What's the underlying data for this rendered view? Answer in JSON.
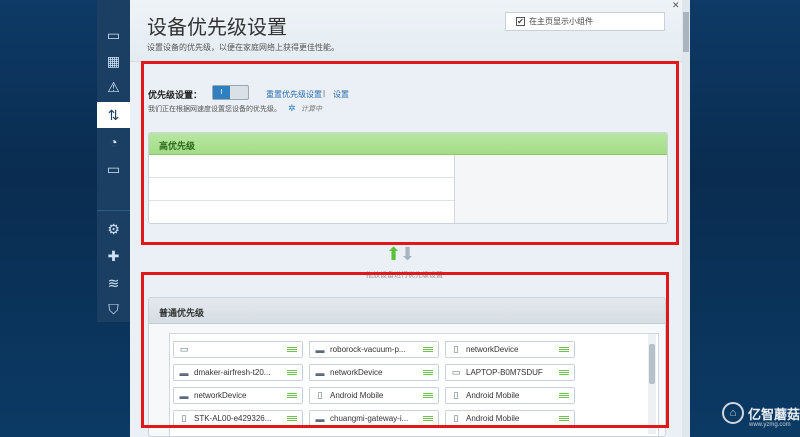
{
  "header": {
    "title": "设备优先级设置",
    "subtitle": "设置设备的优先级，以便在家庭网络上获得更佳性能。",
    "widget_label": "在主页显示小组件"
  },
  "priority": {
    "label": "优先级设置：",
    "toggle_on": "I",
    "reset_link": "重置优先级设置",
    "separator": "|",
    "settings_link": "设置",
    "description": "我们正在根据网速度设置您设备的优先级。",
    "calculating": "计算中"
  },
  "high_priority": {
    "title": "高优先级"
  },
  "arrows_caption": "拖放设备进行优先级设置",
  "normal_priority": {
    "title": "普通优先级",
    "devices": [
      {
        "name": "",
        "icon": "laptop-icon"
      },
      {
        "name": "roborock-vacuum-p...",
        "icon": "router-icon"
      },
      {
        "name": "networkDevice",
        "icon": "phone-icon"
      },
      {
        "name": "dmaker-airfresh-t20...",
        "icon": "router-icon"
      },
      {
        "name": "networkDevice",
        "icon": "router-icon"
      },
      {
        "name": "LAPTOP-B0M7SDUF",
        "icon": "laptop-icon"
      },
      {
        "name": "networkDevice",
        "icon": "router-icon"
      },
      {
        "name": "Android Mobile",
        "icon": "phone-icon"
      },
      {
        "name": "Android Mobile",
        "icon": "phone-icon"
      },
      {
        "name": "STK-AL00-e429326...",
        "icon": "phone-icon"
      },
      {
        "name": "chuangmi-gateway-i...",
        "icon": "router-icon"
      },
      {
        "name": "Android Mobile",
        "icon": "phone-icon"
      }
    ]
  },
  "watermark": {
    "brand": "亿智蘑菇",
    "url": "www.yzmg.com"
  },
  "colors": {
    "accent": "#2f7fc1",
    "highlight_red": "#e01818",
    "high_priority_green": "#a4dc86"
  }
}
